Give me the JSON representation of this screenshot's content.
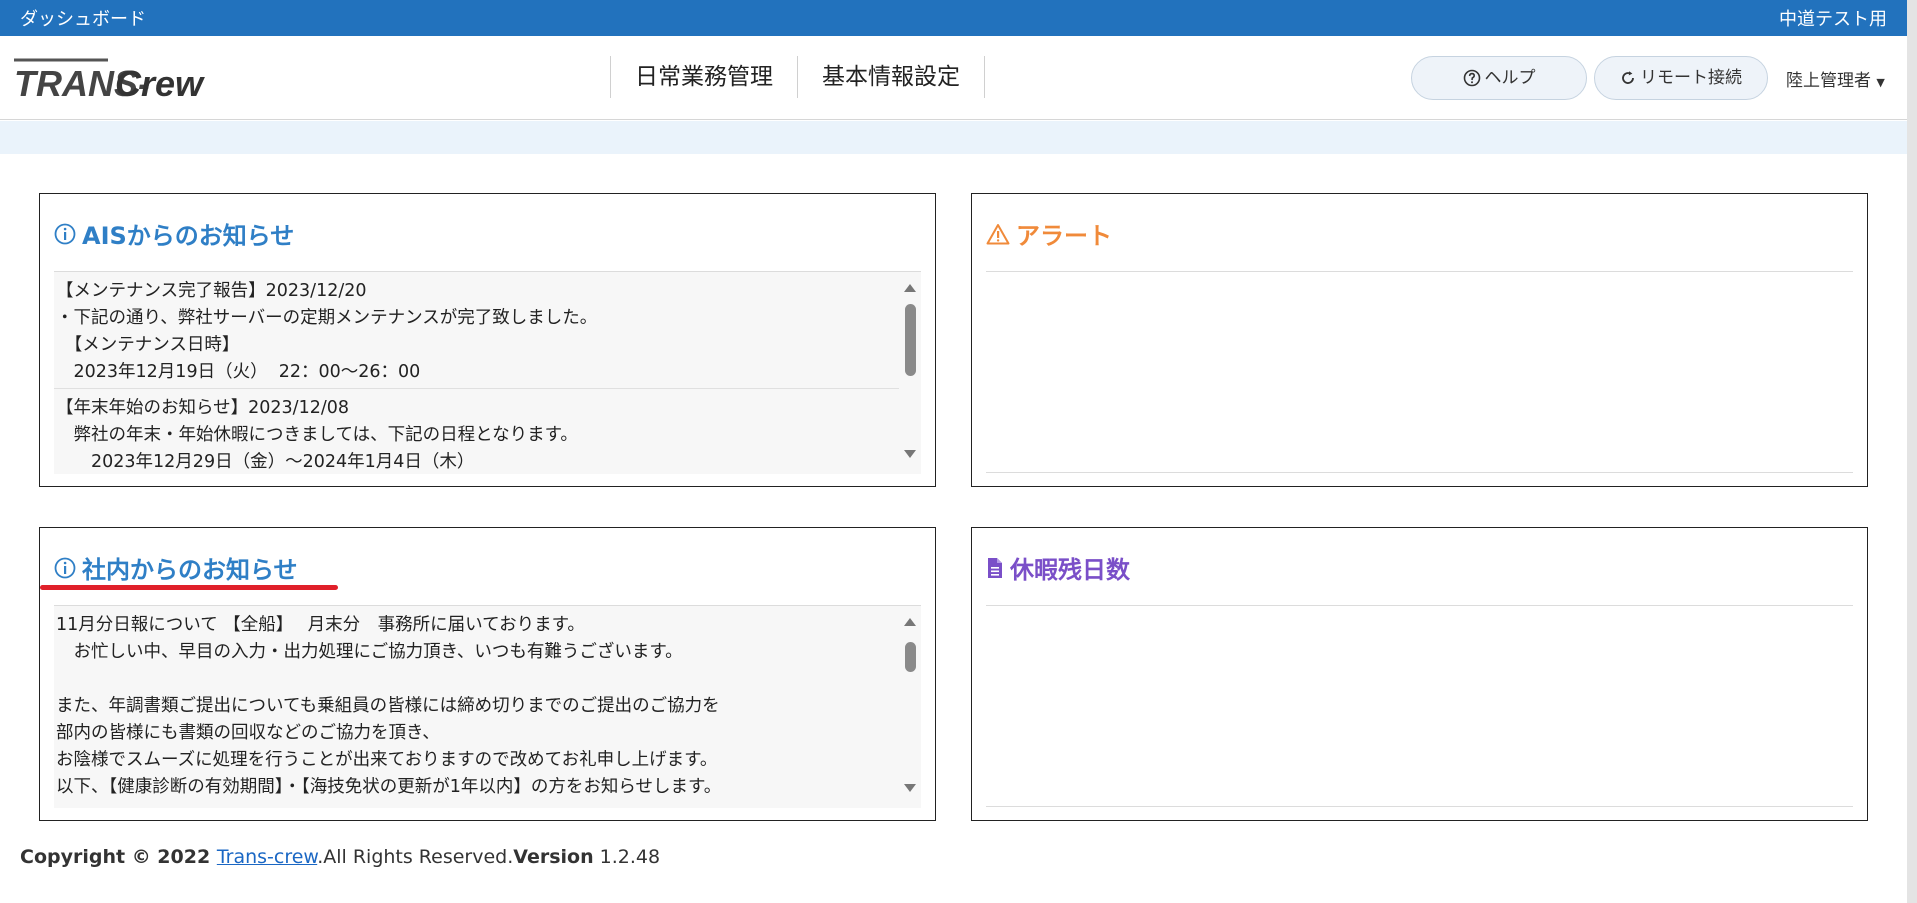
{
  "topbar": {
    "title": "ダッシュボード",
    "env": "中道テスト用"
  },
  "logo": {
    "part1": "TRANS-",
    "part2": "Crew"
  },
  "nav": {
    "items": [
      "日常業務管理",
      "基本情報設定"
    ]
  },
  "header": {
    "help": "ヘルプ",
    "remote": "リモート接続",
    "user": "陸上管理者"
  },
  "cards": {
    "ais": {
      "title": "AISからのお知らせ",
      "entries": [
        {
          "lines": [
            "【メンテナンス完了報告】2023/12/20",
            "・下記の通り、弊社サーバーの定期メンテナンスが完了致しました。",
            "　【メンテナンス日時】",
            "　2023年12月19日（火）  22：00〜26：00"
          ]
        },
        {
          "lines": [
            "【年末年始のお知らせ】2023/12/08",
            "　弊社の年末・年始休暇につきましては、下記の日程となります。",
            "　　2023年12月29日（金）〜2024年1月4日（木）"
          ]
        }
      ]
    },
    "alert": {
      "title": "アラート"
    },
    "internal": {
      "title": "社内からのお知らせ",
      "lines": [
        "11月分日報について 【全船】　 月末分　事務所に届いております。",
        "　お忙しい中、早目の入力・出力処理にご協力頂き、いつも有難うございます。",
        "",
        "また、年調書類ご提出についても乗組員の皆様には締め切りまでのご提出のご協力を",
        "部内の皆様にも書類の回収などのご協力を頂き、",
        "お陰様でスムーズに処理を行うことが出来ておりますので改めてお礼申し上げます。",
        "以下、【健康診断の有効期間】・【海技免状の更新が1年以内】の方をお知らせします。"
      ]
    },
    "leave": {
      "title": "休暇残日数"
    }
  },
  "footer": {
    "copyright": "Copyright © 2022 ",
    "link": "Trans-crew",
    "rights": ".All Rights Reserved.",
    "version_label": "Version",
    "version": " 1.2.48"
  },
  "colors": {
    "topbar": "#2272bd",
    "info_title": "#2f7fc6",
    "alert_title": "#f08a3a",
    "leave_title": "#7a4fc8",
    "annotation": "#e0202a"
  }
}
